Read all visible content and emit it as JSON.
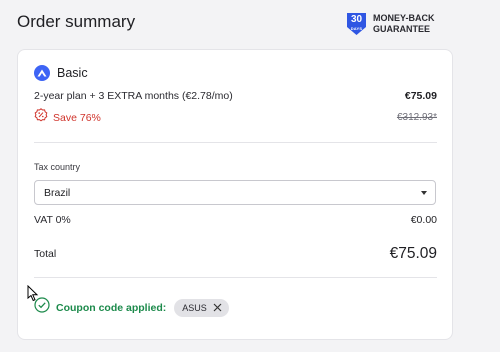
{
  "header": {
    "title": "Order summary",
    "guarantee": {
      "badge_number": "30",
      "badge_unit": "DAYS",
      "line1": "MONEY-BACK",
      "line2": "GUARANTEE"
    }
  },
  "plan": {
    "name": "Basic",
    "description": "2-year plan + 3 EXTRA months (€2.78/mo)",
    "price": "€75.09",
    "save_label": "Save 76%",
    "original_price": "€312.93*"
  },
  "tax": {
    "label": "Tax country",
    "selected_country": "Brazil",
    "vat_label": "VAT 0%",
    "vat_value": "€0.00"
  },
  "total": {
    "label": "Total",
    "value": "€75.09"
  },
  "coupon": {
    "label": "Coupon code applied:",
    "code": "ASUS"
  },
  "colors": {
    "accent": "#3d64f5",
    "save_red": "#d0342c",
    "coupon_green": "#1c8a4b"
  },
  "icons": {
    "plan_logo": "mountain-logo-icon",
    "save": "discount-tag-icon",
    "coupon": "check-circle-icon",
    "chip_remove": "close-icon",
    "select": "chevron-down-icon",
    "guarantee": "shield-badge-icon"
  }
}
